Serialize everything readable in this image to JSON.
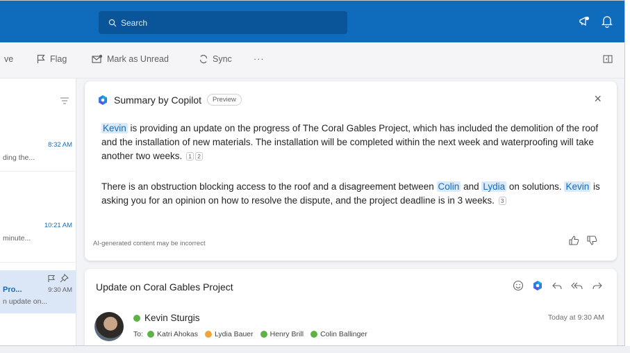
{
  "topbar": {
    "search_placeholder": "Search",
    "accent": "#0f6cbd"
  },
  "toolbar": {
    "partial_left": "ve",
    "flag": "Flag",
    "mark_unread": "Mark as Unread",
    "sync": "Sync",
    "more": "···"
  },
  "list": {
    "rows": [
      {
        "time": "8:32 AM",
        "preview": "ding the..."
      },
      {
        "time": "10:21 AM",
        "preview": "minute..."
      },
      {
        "time": "9:30 AM",
        "sender": "Pro...",
        "preview": "n update on..."
      }
    ]
  },
  "copilot": {
    "title": "Summary by Copilot",
    "badge": "Preview",
    "close_glyph": "×",
    "p1": {
      "name": "Kevin",
      "text": " is providing an update on the progress of  The Coral Gables Project, which has included the demolition of the roof and the installation of new materials. The installation will be completed within the next week and waterproofing will take another two weeks.",
      "refs": [
        "1",
        "2"
      ]
    },
    "p2": {
      "t1": "There is an obstruction blocking access to the roof and a disagreement between ",
      "n1": "Colin",
      "t2": " and ",
      "n2": "Lydia",
      "t3": " on solutions. ",
      "n3": "Kevin",
      "t4": " is asking you for an opinion on how to resolve the dispute, and the project deadline is in 3 weeks.",
      "refs": [
        "3"
      ]
    },
    "disclaimer": "AI-generated content may be incorrect"
  },
  "email": {
    "subject": "Update on Coral Gables Project",
    "sender": "Kevin Sturgis",
    "time": "Today at 9:30 AM",
    "to_label": "To:",
    "recipients": [
      {
        "name": "Katri Ahokas",
        "status": "available"
      },
      {
        "name": "Lydia Bauer",
        "status": "away"
      },
      {
        "name": "Henry Brill",
        "status": "available"
      },
      {
        "name": "Colin Ballinger",
        "status": "available"
      }
    ]
  }
}
